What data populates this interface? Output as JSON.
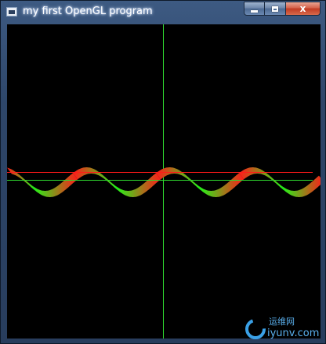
{
  "window": {
    "title": "my first OpenGL program",
    "buttons": {
      "minimize": "minimize",
      "maximize": "maximize",
      "close": "close"
    },
    "close_glyph": "x",
    "title_icon": "app-window-icon"
  },
  "canvas": {
    "background": "#000000",
    "axis_color": "#2fdc2f",
    "red_line_color": "#ff1a1a",
    "wave_colors": {
      "green": "#19ff19",
      "red": "#ff1a1a"
    }
  },
  "watermark": {
    "site_cn": "运维网",
    "site": "iyunv.com"
  }
}
